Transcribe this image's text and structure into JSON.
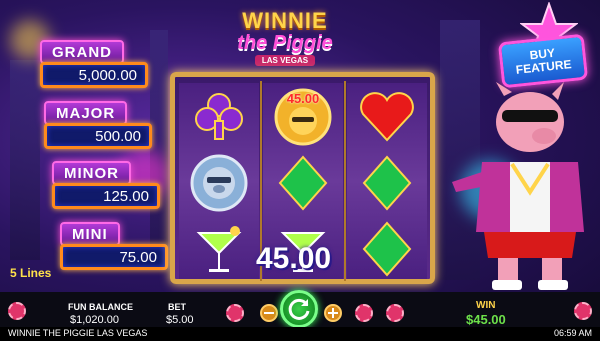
{
  "game": {
    "logo_title": "WINNIE",
    "logo_sub": "the Piggie",
    "logo_location": "LAS VEGAS"
  },
  "jackpots": [
    {
      "name": "GRAND",
      "value": "5,000.00"
    },
    {
      "name": "MAJOR",
      "value": "500.00"
    },
    {
      "name": "MINOR",
      "value": "125.00"
    },
    {
      "name": "MINI",
      "value": "75.00"
    }
  ],
  "lines_label": "5 Lines",
  "reels": [
    [
      "club",
      "coin",
      "wild-pig"
    ],
    [
      "heart",
      "diamond",
      "cocktail"
    ],
    [
      "heart",
      "diamond",
      "diamond"
    ]
  ],
  "coin_symbol_value": "45.00",
  "win_overlay": "45.00",
  "buy_feature": {
    "line1": "BUY",
    "line2": "FEATURE"
  },
  "bottom": {
    "fun_balance_label": "FUN BALANCE",
    "fun_balance_value": "$1,020.00",
    "bet_label": "BET",
    "bet_value": "$5.00",
    "win_label": "WIN",
    "win_value": "$45.00",
    "title": "WINNIE THE PIGGIE LAS VEGAS",
    "clock": "06:59 AM"
  },
  "colors": {
    "accent": "#ff4fd8",
    "gold": "#ffd44a",
    "win_green": "#6de04a"
  }
}
